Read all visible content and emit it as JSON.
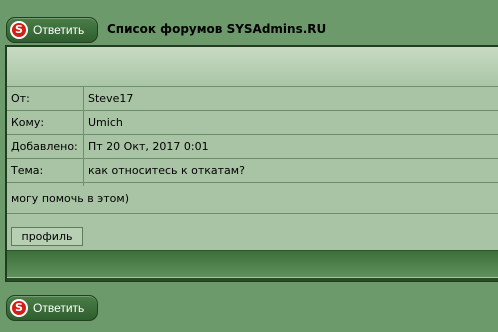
{
  "top": {
    "reply_label": "Ответить",
    "reply_icon": "S",
    "forum_list_link": "Список форумов SYSAdmins.RU"
  },
  "post": {
    "fields": [
      {
        "key": "От:",
        "value": "Steve17"
      },
      {
        "key": "Кому:",
        "value": "Umich"
      },
      {
        "key": "Добавлено:",
        "value": "Пт 20 Окт, 2017 0:01"
      },
      {
        "key": "Тема:",
        "value": "как относитесь к откатам?"
      }
    ],
    "message": "могу помочь в этом)",
    "profile_label": "профиль"
  },
  "bottom": {
    "reply_label": "Ответить",
    "reply_icon": "S"
  },
  "colors": {
    "page_bg": "#6d9a6a",
    "panel_bg": "#a9c4a5",
    "button_bg": "#3f7440",
    "icon_red": "#d51e16"
  }
}
